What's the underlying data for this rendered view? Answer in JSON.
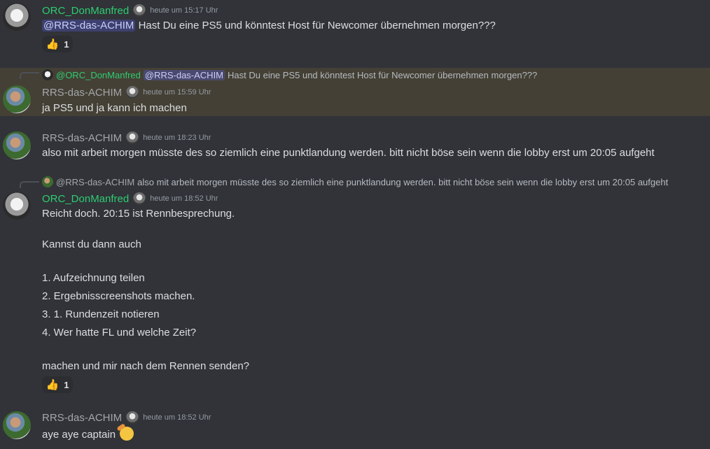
{
  "messages": [
    {
      "author": "ORC_DonManfred",
      "timestamp": "heute um 15:17 Uhr",
      "mention": "@RRS-das-ACHIM",
      "text": " Hast Du eine PS5 und könntest Host für Newcomer übernehmen morgen???",
      "reaction": {
        "emoji": "👍",
        "count": "1"
      }
    },
    {
      "reply_author": "@ORC_DonManfred",
      "reply_mention": "@RRS-das-ACHIM",
      "reply_text": "Hast Du eine PS5 und könntest Host für Newcomer übernehmen morgen???",
      "author": "RRS-das-ACHIM",
      "timestamp": "heute um 15:59 Uhr",
      "text": "ja PS5 und ja kann ich machen"
    },
    {
      "author": "RRS-das-ACHIM",
      "timestamp": "heute um 18:23 Uhr",
      "text": "also mit arbeit morgen müsste des so ziemlich eine punktlandung werden. bitt nicht böse sein wenn die lobby erst um 20:05 aufgeht"
    },
    {
      "reply_author": "@RRS-das-ACHIM",
      "reply_text": "also mit arbeit morgen müsste des so ziemlich eine punktlandung werden. bitt nicht böse sein wenn die lobby erst um 20:05 aufgeht",
      "author": "ORC_DonManfred",
      "timestamp": "heute um 18:52 Uhr",
      "lines": [
        "Reicht doch. 20:15 ist Rennbesprechung.",
        "Kannst du dann auch",
        "1. Aufzeichnung teilen",
        "2. Ergebnisscreenshots machen.",
        "3. 1. Rundenzeit notieren",
        "4. Wer hatte FL und welche Zeit?",
        "machen und mir nach dem Rennen senden?"
      ],
      "reaction": {
        "emoji": "👍",
        "count": "1"
      }
    },
    {
      "author": "RRS-das-ACHIM",
      "timestamp": "heute um 18:52 Uhr",
      "text": "aye aye captain",
      "emoji": "saluting-face"
    }
  ],
  "colors": {
    "background": "#313338",
    "highlight": "#444035",
    "green_author": "#2ecc71",
    "mention_bg": "#5865f2"
  }
}
